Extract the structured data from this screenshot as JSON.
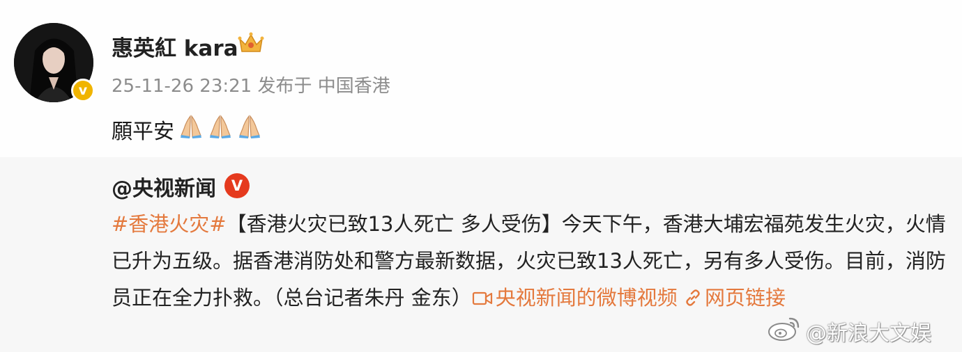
{
  "post": {
    "username": "惠英紅 kara",
    "badge_letter": "v",
    "meta": "25-11-26 23:21 发布于 中国香港",
    "text": "願平安",
    "emojis": [
      "pray-emoji",
      "pray-emoji",
      "pray-emoji"
    ],
    "icons": [
      "crown-icon",
      "verified-icon"
    ]
  },
  "repost": {
    "original_user": "@央视新闻",
    "badge_letter": "V",
    "hashtag": "#香港火灾#",
    "body": "【香港火灾已致13人死亡 多人受伤】今天下午，香港大埔宏福苑发生火灾，火情已升为五级。据香港消防处和警方最新数据，火灾已致13人死亡，另有多人受伤。目前，消防员正在全力扑救。（总台记者朱丹 金东）",
    "video_link": "央视新闻的微博视频",
    "web_link": "网页链接"
  },
  "watermark": {
    "text": "@新浪大文娱",
    "icon": "weibo-logo-icon"
  },
  "colors": {
    "link": "#e4793d",
    "meta": "#8c8c8c",
    "repost_bg": "#f7f7f7",
    "gold_badge": "#f0b400",
    "red_badge": "#e53a1e"
  }
}
